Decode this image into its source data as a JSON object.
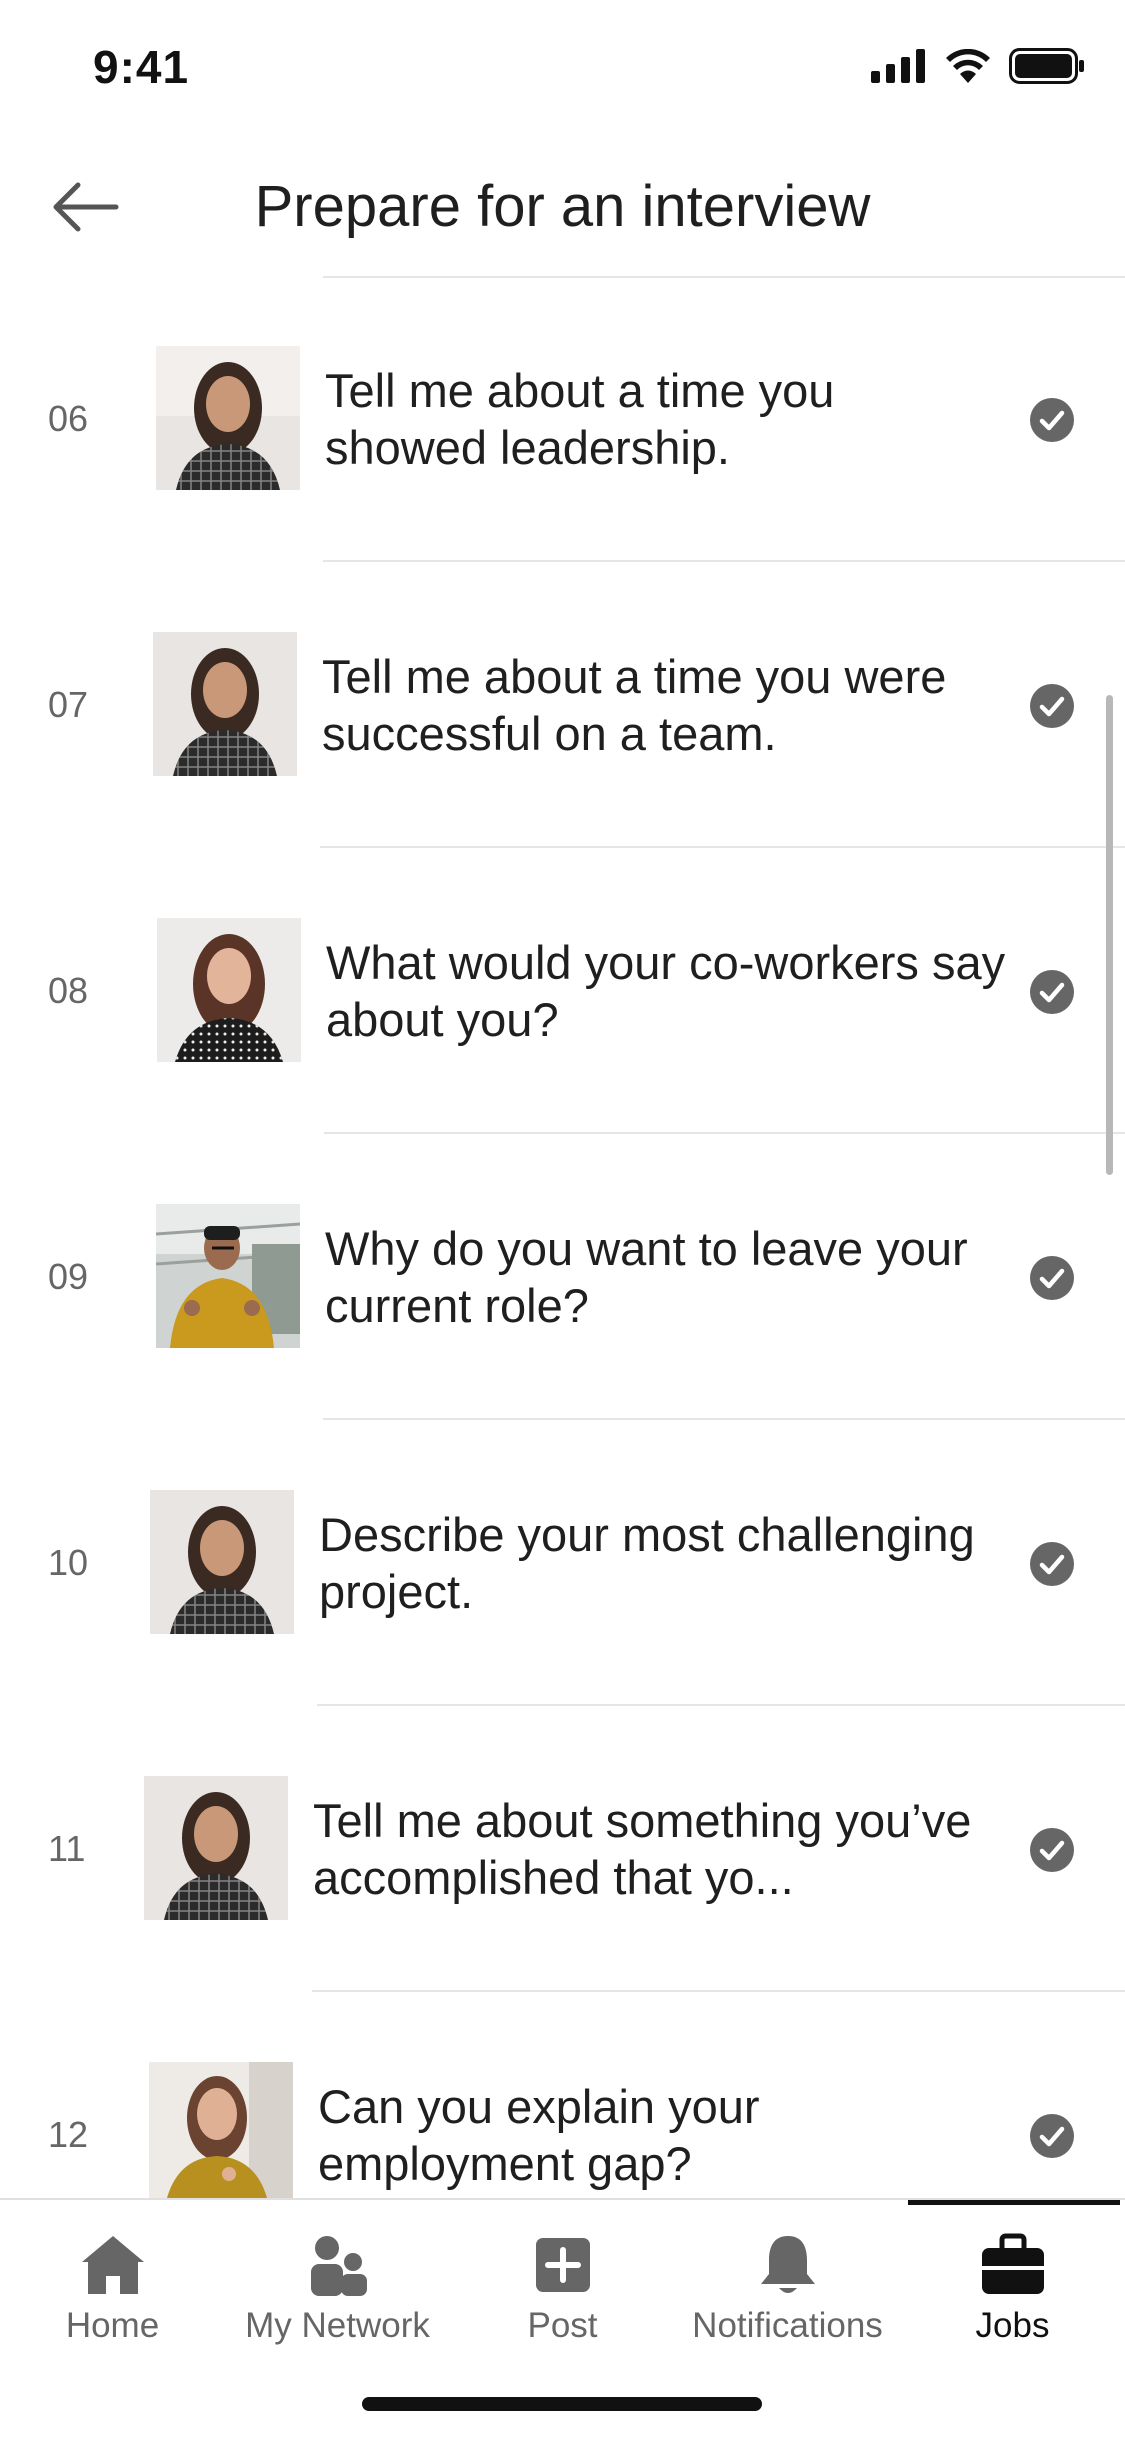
{
  "status": {
    "time": "9:41"
  },
  "header": {
    "title": "Prepare for an interview"
  },
  "questions": [
    {
      "number": "06",
      "text": "Tell me about a time you showed leadership.",
      "completed": true
    },
    {
      "number": "07",
      "text": "Tell me about a time you were successful on a team.",
      "completed": true
    },
    {
      "number": "08",
      "text": "What would your co-workers say about you?",
      "completed": true
    },
    {
      "number": "09",
      "text": "Why do you want to leave your current role?",
      "completed": true
    },
    {
      "number": "10",
      "text": "Describe your most challenging project.",
      "completed": true
    },
    {
      "number": "11",
      "text": "Tell me about something you’ve accomplished that yo...",
      "completed": true
    },
    {
      "number": "12",
      "text": "Can you explain your employment gap?",
      "completed": true
    }
  ],
  "tabs": [
    {
      "label": "Home",
      "icon": "home-icon"
    },
    {
      "label": "My Network",
      "icon": "network-icon"
    },
    {
      "label": "Post",
      "icon": "post-icon"
    },
    {
      "label": "Notifications",
      "icon": "bell-icon"
    },
    {
      "label": "Jobs",
      "icon": "briefcase-icon",
      "active": true
    }
  ],
  "colors": {
    "text": "#1f1f1f",
    "muted": "#666666",
    "check": "#666666"
  }
}
